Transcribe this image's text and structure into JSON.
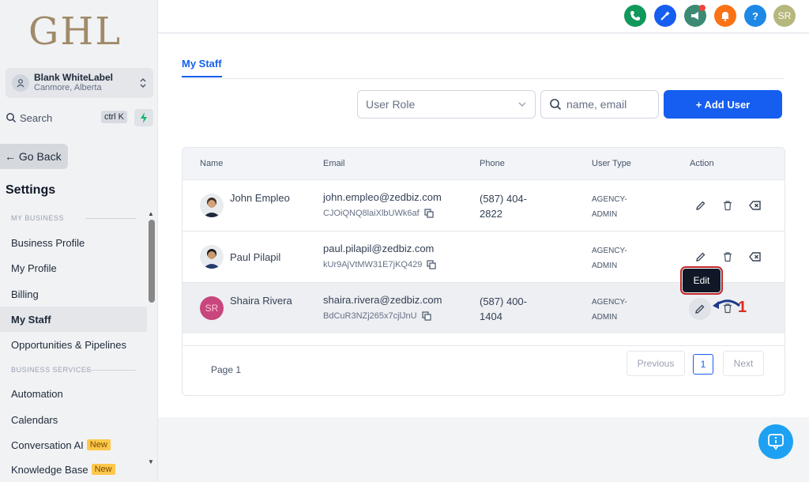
{
  "brand": {
    "logo": "GHL"
  },
  "location": {
    "name": "Blank WhiteLabel",
    "address": "Canmore, Alberta"
  },
  "search": {
    "label": "Search",
    "shortcut": "ctrl K"
  },
  "goback": {
    "label": "← Go Back"
  },
  "settings": {
    "title": "Settings",
    "section_my_business": "MY BUSINESS",
    "section_business_services": "BUSINESS SERVICES",
    "items": [
      {
        "label": "Business Profile"
      },
      {
        "label": "My Profile"
      },
      {
        "label": "Billing"
      },
      {
        "label": "My Staff"
      },
      {
        "label": "Opportunities & Pipelines"
      },
      {
        "label": "Automation"
      },
      {
        "label": "Calendars"
      },
      {
        "label": "Conversation AI",
        "badge": "New"
      },
      {
        "label": "Knowledge Base",
        "badge": "New"
      }
    ]
  },
  "header": {
    "avatar_initials": "SR",
    "help": "?"
  },
  "page": {
    "tab": "My Staff",
    "role_select": "User Role",
    "search_placeholder": "name, email",
    "add_user": "+ Add User"
  },
  "table": {
    "headers": [
      "Name",
      "Email",
      "Phone",
      "User Type",
      "Action"
    ],
    "rows": [
      {
        "name": "John Empleo",
        "email": "john.empleo@zedbiz.com",
        "id": "CJOiQNQ8laiXlbUWk6af",
        "phone": "(587) 404-2822",
        "type": "AGENCY-ADMIN"
      },
      {
        "name": "Paul Pilapil",
        "email": "paul.pilapil@zedbiz.com",
        "id": "kUr9AjVtMW31E7jKQ429",
        "phone": "",
        "type": "AGENCY-ADMIN"
      },
      {
        "name": "Shaira Rivera",
        "email": "shaira.rivera@zedbiz.com",
        "id": "BdCuR3NZj265x7cjlJnU",
        "phone": "(587) 400-1404",
        "type": "AGENCY-ADMIN",
        "initials": "SR"
      }
    ]
  },
  "pagination": {
    "label": "Page 1",
    "previous": "Previous",
    "current": "1",
    "next": "Next"
  },
  "tooltip": {
    "text": "Edit"
  },
  "annotation": {
    "number": "1"
  },
  "colors": {
    "primary": "#155eef",
    "annotation_red": "#d92d20",
    "logo_gold": "#a08a6a"
  }
}
